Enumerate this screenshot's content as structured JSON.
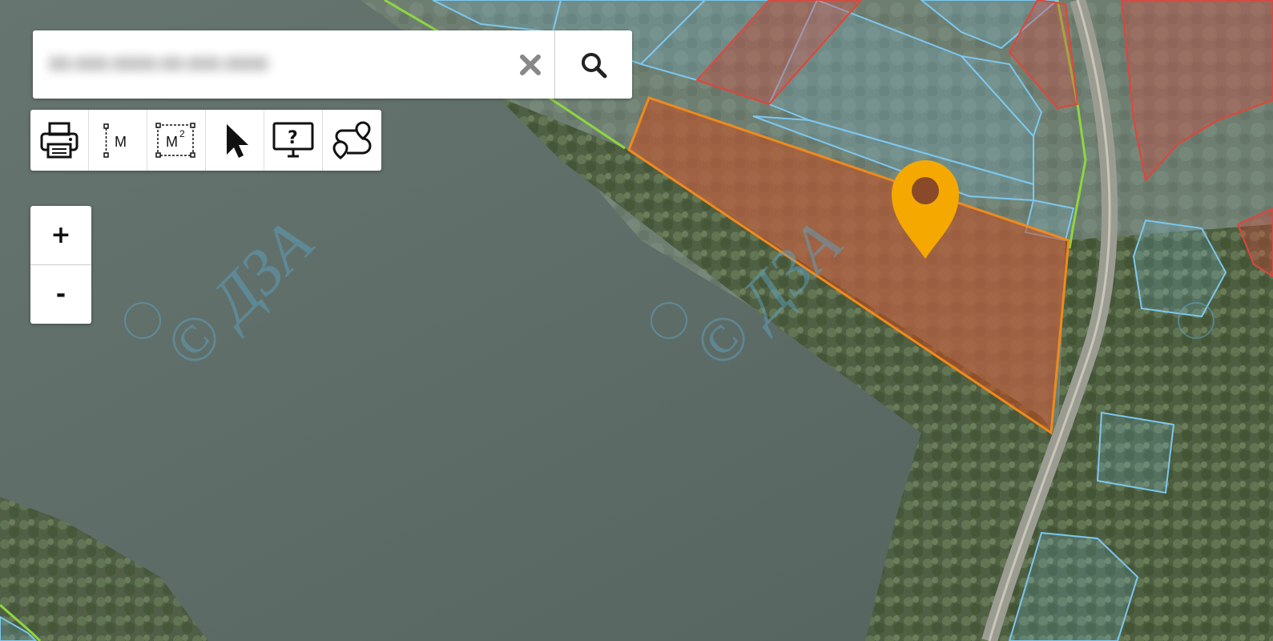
{
  "search": {
    "value": "00:000:0000:00:000:0000",
    "clear_icon": "close-icon",
    "search_icon": "search-icon"
  },
  "toolbar": {
    "tools": [
      {
        "name": "print-tool",
        "icon": "printer-icon"
      },
      {
        "name": "measure-distance-tool",
        "icon": "ruler-icon",
        "label": "M"
      },
      {
        "name": "measure-area-tool",
        "icon": "area-icon",
        "label": "M",
        "sup": "2"
      },
      {
        "name": "select-tool",
        "icon": "cursor-icon"
      },
      {
        "name": "info-tool",
        "icon": "monitor-help-icon",
        "label": "?"
      },
      {
        "name": "route-tool",
        "icon": "route-icon"
      }
    ]
  },
  "zoom": {
    "in_label": "+",
    "out_label": "-"
  },
  "map": {
    "watermark": "© ДЗА",
    "colors": {
      "water": "#5e6d6b",
      "vegetation": "#57684b",
      "parcel_blue": "#7cc7ef",
      "parcel_red": "#e0453a",
      "selected_parcel": "#f08a1c",
      "marker": "#f5a800",
      "boundary_green": "#8ed63f"
    }
  }
}
